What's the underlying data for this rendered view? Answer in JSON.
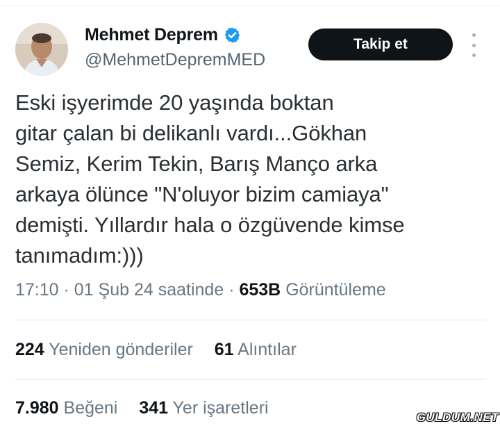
{
  "author": {
    "name": "Mehmet Deprem",
    "handle": "@MehmetDepremMED",
    "verified_color": "#1d9bf0"
  },
  "follow_button": {
    "label": "Takip et"
  },
  "tweet": {
    "lines": [
      "Eski işyerimde 20 yaşında boktan",
      "gitar çalan bi delikanlı vardı...Gökhan",
      "Semiz, Kerim Tekin, Barış Manço arka",
      "arkaya ölünce \"N'oluyor bizim camiaya\"",
      "demişti. Yıllardır hala o özgüvende kimse",
      "tanımadım:)))"
    ]
  },
  "meta": {
    "time": "17:10",
    "separator": " · ",
    "date": "01 Şub 24 saatinde",
    "views_count": "653B",
    "views_label": "Görüntüleme"
  },
  "stats": {
    "reposts_count": "224",
    "reposts_label": "Yeniden gönderiler",
    "quotes_count": "61",
    "quotes_label": "Alıntılar",
    "likes_count": "7.980",
    "likes_label": "Beğeni",
    "bookmarks_count": "341",
    "bookmarks_label": "Yer işaretleri"
  },
  "watermark": {
    "text": "GULDUM.NET"
  }
}
